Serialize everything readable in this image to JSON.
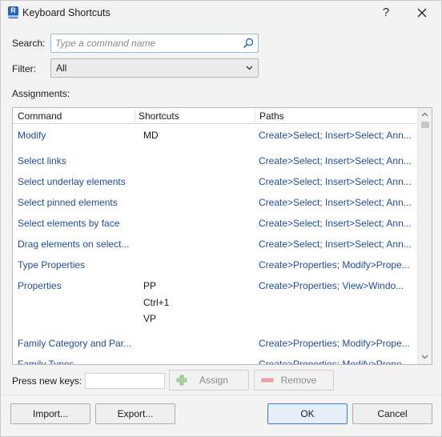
{
  "window": {
    "title": "Keyboard Shortcuts",
    "icon_letter": "R",
    "help_label": "?",
    "close_icon": "close-icon"
  },
  "search": {
    "label": "Search:",
    "placeholder": "Type a command name",
    "value": "",
    "icon": "search-icon"
  },
  "filter": {
    "label": "Filter:",
    "selected": "All"
  },
  "assignments": {
    "label": "Assignments:",
    "columns": [
      "Command",
      "Shortcuts",
      "Paths"
    ],
    "rows": [
      {
        "command": "Modify",
        "shortcuts": [
          "MD"
        ],
        "paths": "Create>Select; Insert>Select; Ann..."
      },
      {
        "command": "Select links",
        "shortcuts": [],
        "paths": "Create>Select; Insert>Select; Ann..."
      },
      {
        "command": "Select underlay elements",
        "shortcuts": [],
        "paths": "Create>Select; Insert>Select; Ann..."
      },
      {
        "command": "Select pinned elements",
        "shortcuts": [],
        "paths": "Create>Select; Insert>Select; Ann..."
      },
      {
        "command": "Select elements by face",
        "shortcuts": [],
        "paths": "Create>Select; Insert>Select; Ann..."
      },
      {
        "command": "Drag elements on select...",
        "shortcuts": [],
        "paths": "Create>Select; Insert>Select; Ann..."
      },
      {
        "command": "Type Properties",
        "shortcuts": [],
        "paths": "Create>Properties; Modify>Prope..."
      },
      {
        "command": "Properties",
        "shortcuts": [
          "PP",
          "Ctrl+1",
          "VP"
        ],
        "paths": "Create>Properties; View>Windo..."
      },
      {
        "command": "Family Category and Par...",
        "shortcuts": [],
        "paths": "Create>Properties; Modify>Prope..."
      },
      {
        "command": "Family Types",
        "shortcuts": [],
        "paths": "Create>Properties; Modify>Prope..."
      }
    ]
  },
  "keys": {
    "label": "Press new keys:",
    "value": "",
    "assign_label": "Assign",
    "remove_label": "Remove"
  },
  "footer": {
    "import_label": "Import...",
    "export_label": "Export...",
    "ok_label": "OK",
    "cancel_label": "Cancel"
  }
}
